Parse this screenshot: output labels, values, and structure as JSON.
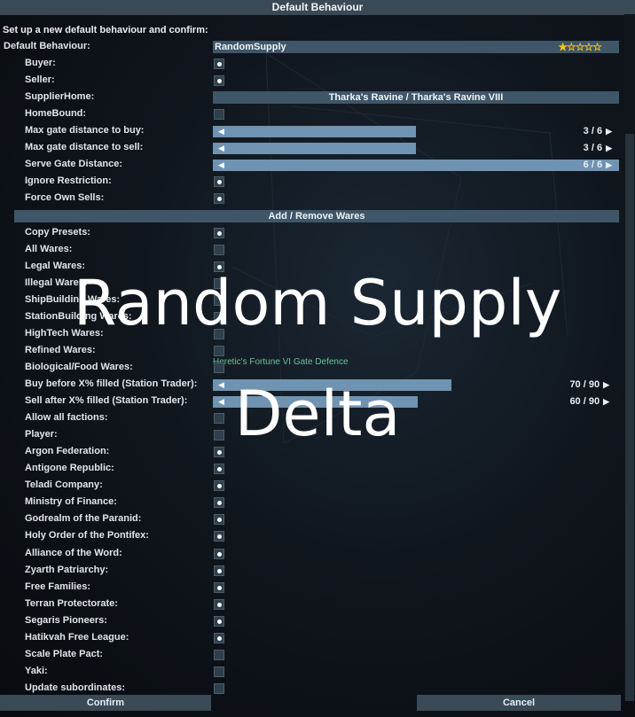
{
  "window": {
    "title": "Default Behaviour"
  },
  "subtitle": "Set up a new default behaviour and confirm:",
  "default_behaviour": {
    "label": "Default Behaviour:",
    "value": "RandomSupply",
    "stars": "★☆☆☆☆",
    "rating": 1,
    "rating_max": 5
  },
  "options": [
    {
      "label": "Buyer:",
      "checked": true
    },
    {
      "label": "Seller:",
      "checked": true
    }
  ],
  "supplier_home": {
    "label": "SupplierHome:",
    "value": "Tharka's Ravine / Tharka's Ravine VIII"
  },
  "homebound": {
    "label": "HomeBound:",
    "checked": false
  },
  "sliders_top": [
    {
      "label": "Max gate distance to buy:",
      "value": 3,
      "max": 6,
      "text": "3 / 6"
    },
    {
      "label": "Max gate distance to sell:",
      "value": 3,
      "max": 6,
      "text": "3 / 6"
    },
    {
      "label": "Serve Gate Distance:",
      "value": 6,
      "max": 6,
      "text": "6 / 6"
    }
  ],
  "options2": [
    {
      "label": "Ignore Restriction:",
      "checked": true
    },
    {
      "label": "Force Own Sells:",
      "checked": true
    }
  ],
  "wares_section": "Add / Remove Wares",
  "wares": [
    {
      "label": "Copy Presets:",
      "checked": true
    },
    {
      "label": "All Wares:",
      "checked": false
    },
    {
      "label": "Legal Wares:",
      "checked": true
    },
    {
      "label": "Illegal Wares:",
      "checked": false
    },
    {
      "label": "ShipBuilding Wares:",
      "checked": false
    },
    {
      "label": "StationBuilding Wares:",
      "checked": false
    },
    {
      "label": "HighTech Wares:",
      "checked": false
    },
    {
      "label": "Refined Wares:",
      "checked": false
    },
    {
      "label": "Biological/Food Wares:",
      "checked": false
    }
  ],
  "trader_sliders": [
    {
      "label": "Buy before X% filled (Station Trader):",
      "value": 70,
      "max": 90,
      "text": "70 / 90"
    },
    {
      "label": "Sell after X% filled (Station Trader):",
      "value": 60,
      "max": 90,
      "text": "60 / 90"
    }
  ],
  "factions": [
    {
      "label": "Allow all factions:",
      "checked": false
    },
    {
      "label": "Player:",
      "checked": false
    },
    {
      "label": "Argon Federation:",
      "checked": true
    },
    {
      "label": "Antigone Republic:",
      "checked": true
    },
    {
      "label": "Teladi Company:",
      "checked": true
    },
    {
      "label": "Ministry of Finance:",
      "checked": true
    },
    {
      "label": "Godrealm of the Paranid:",
      "checked": true
    },
    {
      "label": "Holy Order of the Pontifex:",
      "checked": true
    },
    {
      "label": "Alliance of the Word:",
      "checked": true
    },
    {
      "label": "Zyarth Patriarchy:",
      "checked": true
    },
    {
      "label": "Free Families:",
      "checked": true
    },
    {
      "label": "Terran Protectorate:",
      "checked": true
    },
    {
      "label": "Segaris Pioneers:",
      "checked": true
    },
    {
      "label": "Hatikvah Free League:",
      "checked": true
    },
    {
      "label": "Scale Plate Pact:",
      "checked": false
    },
    {
      "label": "Yaki:",
      "checked": false
    },
    {
      "label": "Update subordinates:",
      "checked": false
    }
  ],
  "footer": {
    "confirm": "Confirm",
    "cancel": "Cancel"
  },
  "map_label": "Heretic's Fortune VI Gate Defence",
  "overlay": {
    "line1": "Random Supply",
    "line2": "Delta"
  }
}
